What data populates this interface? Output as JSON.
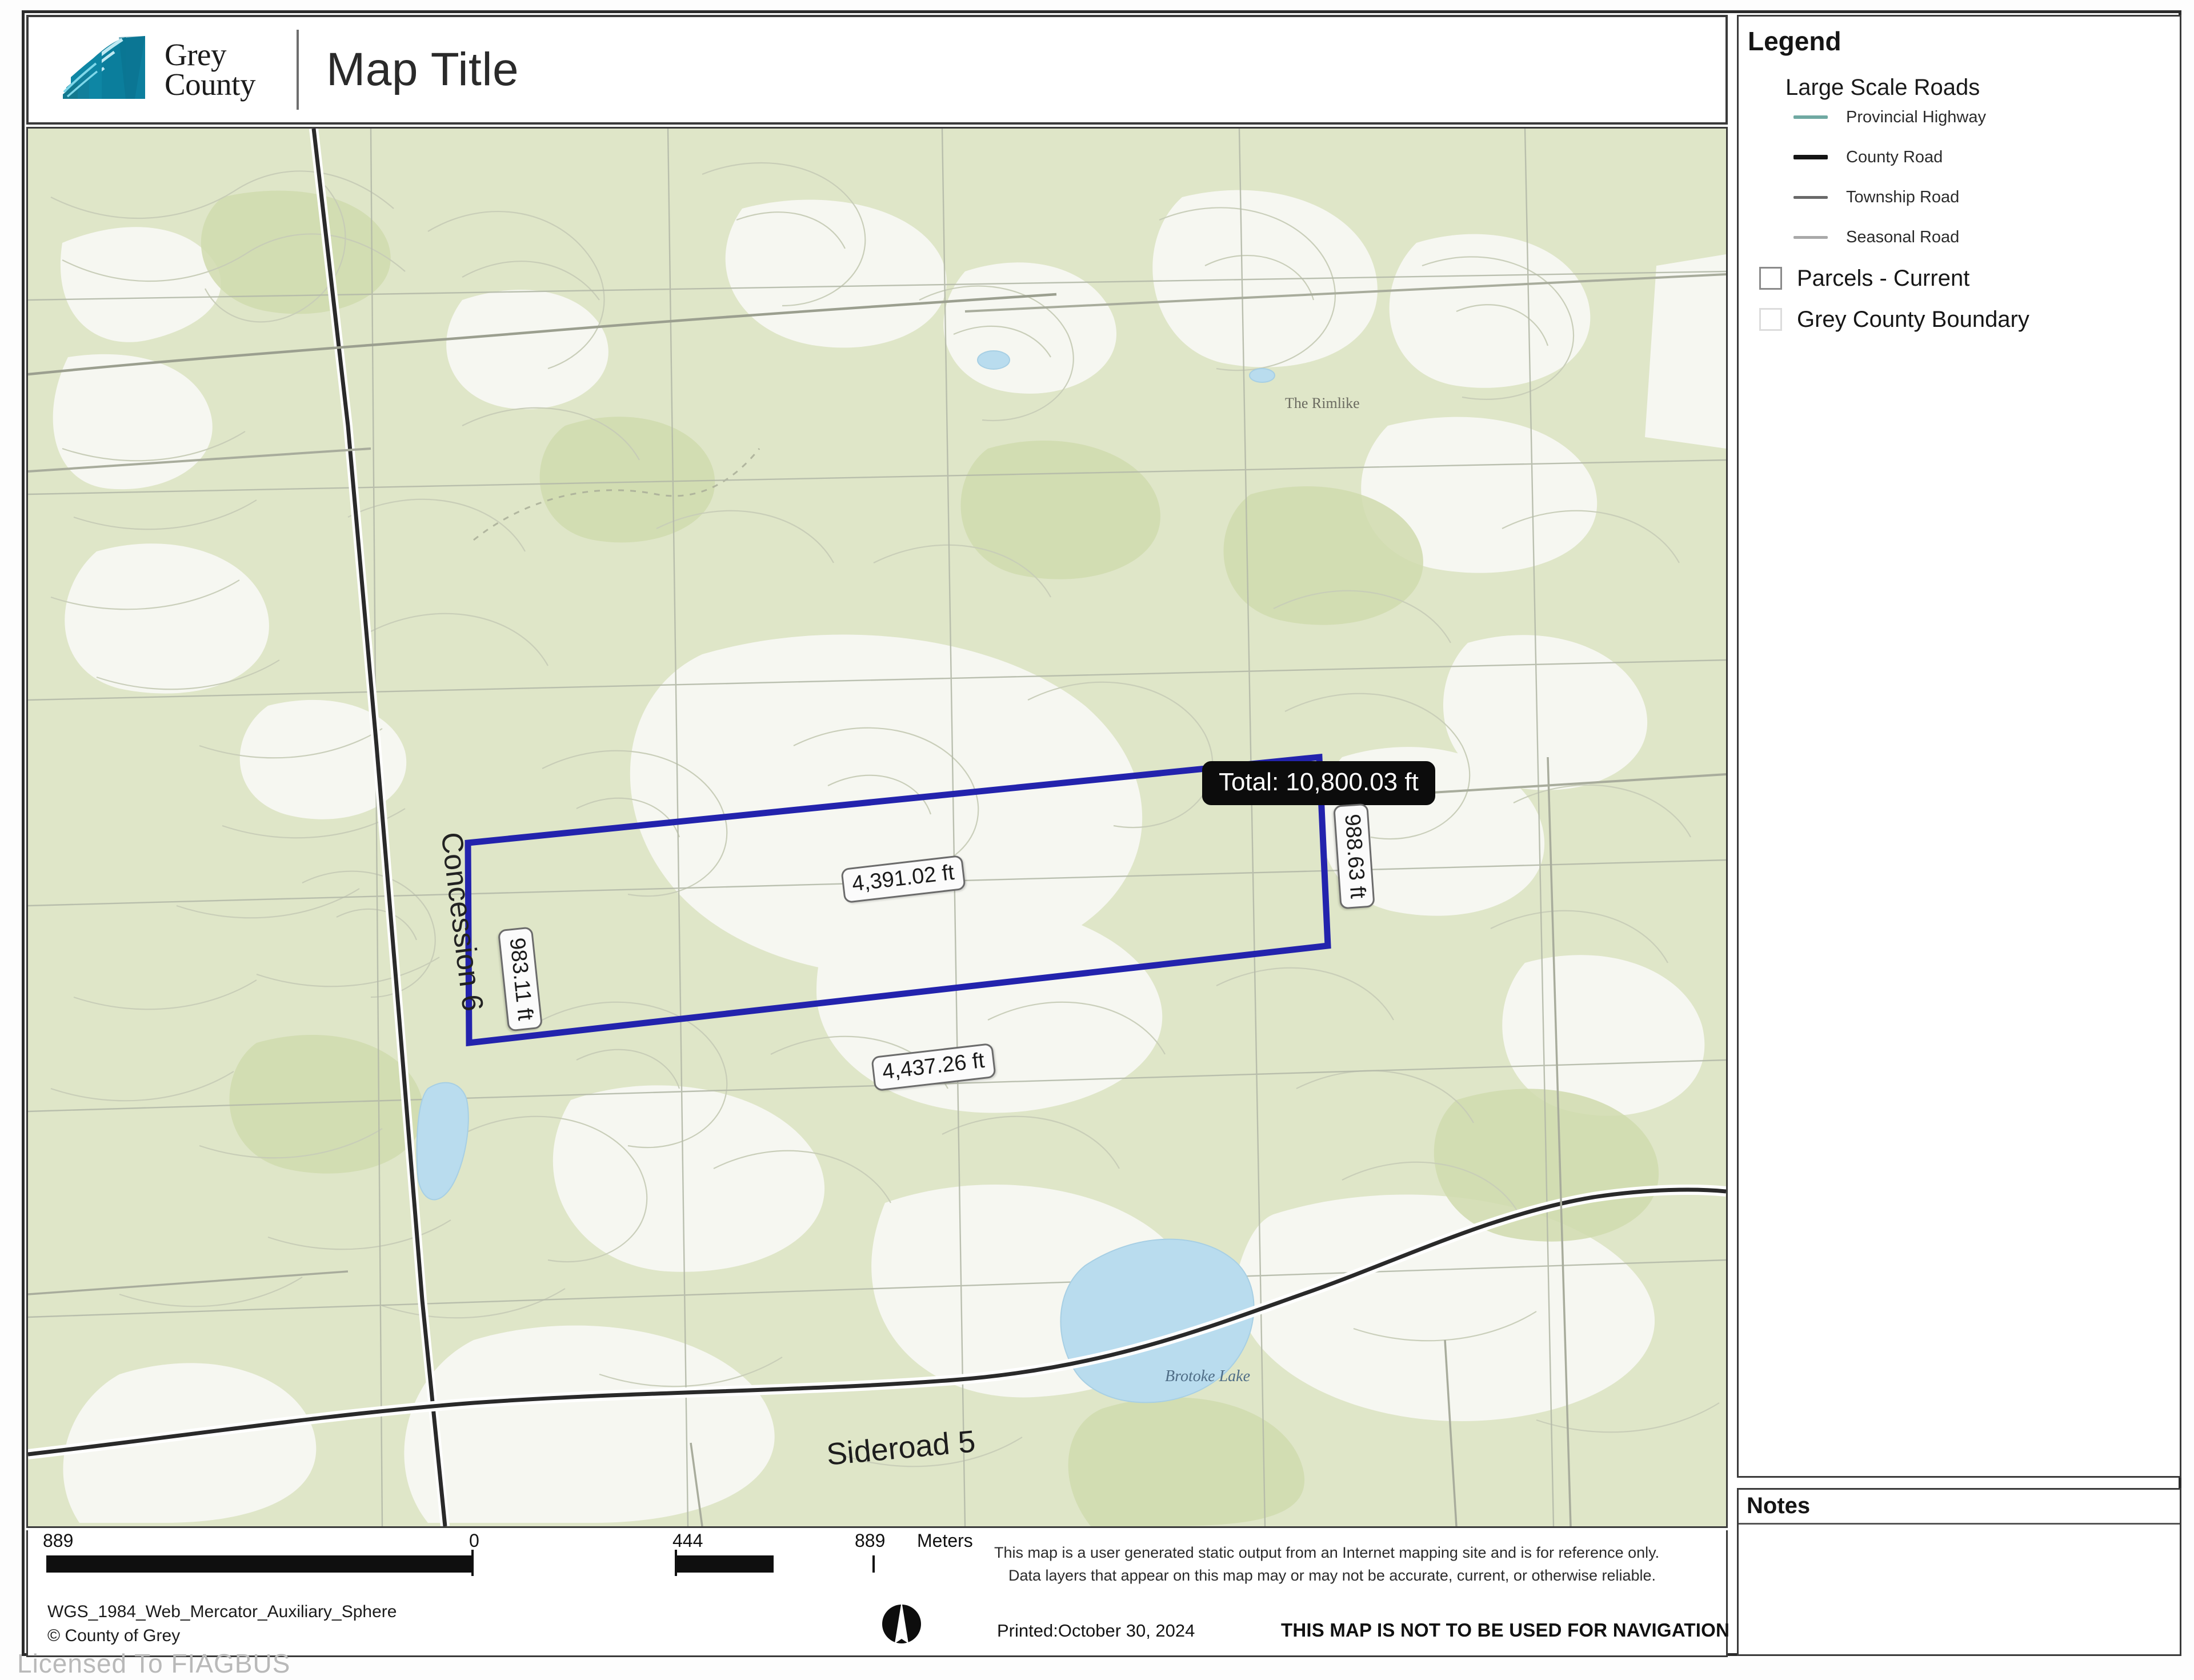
{
  "header": {
    "logo_line1": "Grey",
    "logo_line2": "County",
    "title": "Map Title"
  },
  "map": {
    "measurements": {
      "total": "Total: 10,800.03 ft",
      "top": "4,391.02 ft",
      "bottom": "4,437.26 ft",
      "right": "988.63 ft",
      "left": "983.11 ft"
    },
    "labels": {
      "road_concession": "Concession 6",
      "road_sideroad": "Sideroad 5",
      "lake": "Brotoke Lake",
      "place": "The Rimlike"
    },
    "colors": {
      "measure_line": "#2323ad",
      "terrain_green": "#dfe6c8",
      "terrain_pale": "#f4f6ee",
      "water": "#b9dcee",
      "contour": "#c3c8b4",
      "road_dark": "#2a2a2a"
    }
  },
  "legend": {
    "title": "Legend",
    "group_title": "Large Scale Roads",
    "road_items": [
      {
        "label": "Provincial Highway",
        "color": "#6fa9a2"
      },
      {
        "label": "County Road",
        "color": "#141414"
      },
      {
        "label": "Township Road",
        "color": "#696969"
      },
      {
        "label": "Seasonal Road",
        "color": "#a9a9a9"
      }
    ],
    "poly_items": [
      {
        "label": "Parcels - Current",
        "fill": "#ffffff",
        "stroke": "#8a8a8a"
      },
      {
        "label": "Grey County Boundary",
        "fill": "#ffffff",
        "stroke": "#d8d8d8"
      }
    ]
  },
  "notes": {
    "title": "Notes",
    "body": ""
  },
  "scale": {
    "left_label": "889",
    "zero_label": "0",
    "mid_label": "444",
    "right_label": "889",
    "unit": "Meters"
  },
  "footer": {
    "projection": "WGS_1984_Web_Mercator_Auxiliary_Sphere",
    "copyright": "© County of Grey",
    "disclaimer_line1": "This map is a user generated static output from an Internet mapping site and is for reference only.",
    "disclaimer_line2": "Data layers that appear on this map may or may not be accurate, current, or otherwise reliable.",
    "printed": "Printed:October 30, 2024",
    "no_navigation": "THIS MAP IS NOT TO BE USED FOR NAVIGATION"
  },
  "watermark": "Licensed To FIAGBUS"
}
